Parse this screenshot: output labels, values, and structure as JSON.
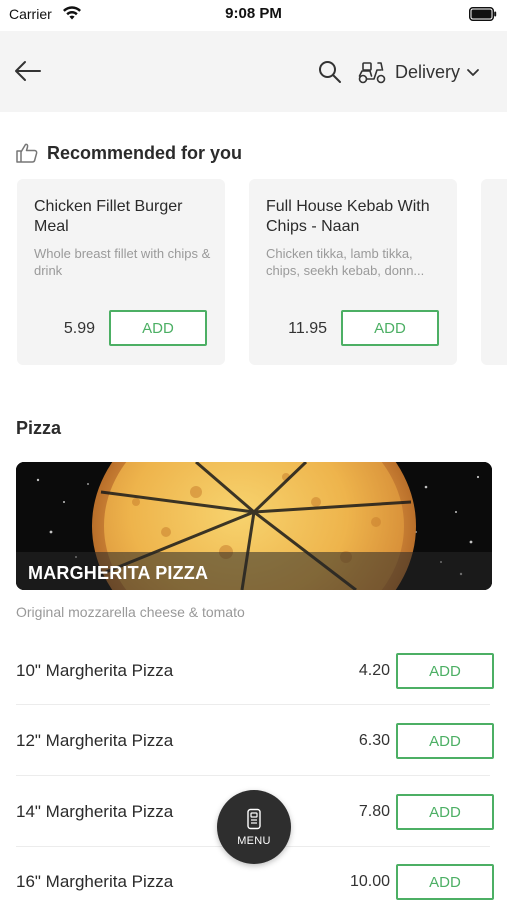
{
  "status_bar": {
    "carrier": "Carrier",
    "time": "9:08 PM"
  },
  "top_bar": {
    "delivery_label": "Delivery",
    "icons": [
      "back-arrow-icon",
      "search-icon",
      "scooter-icon",
      "chevron-down-icon"
    ]
  },
  "recommended": {
    "title": "Recommended for you",
    "icon": "thumbs-up-icon",
    "cards": [
      {
        "name": "Chicken Fillet Burger Meal",
        "description": "Whole breast fillet with chips & drink",
        "price": "5.99",
        "add_label": "ADD"
      },
      {
        "name": "Full House Kebab With Chips - Naan",
        "description": "Chicken tikka, lamb tikka, chips, seekh kebab, donn...",
        "price": "11.95",
        "add_label": "ADD"
      }
    ]
  },
  "section": {
    "title": "Pizza",
    "banner_title": "MARGHERITA PIZZA",
    "description": "Original mozzarella cheese & tomato",
    "items": [
      {
        "name": "10\" Margherita Pizza",
        "price": "4.20",
        "add_label": "ADD"
      },
      {
        "name": "12\" Margherita Pizza",
        "price": "6.30",
        "add_label": "ADD"
      },
      {
        "name": "14\" Margherita Pizza",
        "price": "7.80",
        "add_label": "ADD"
      },
      {
        "name": "16\" Margherita Pizza",
        "price": "10.00",
        "add_label": "ADD"
      }
    ]
  },
  "menu_button": {
    "label": "MENU",
    "icon": "menu-card-icon"
  },
  "colors": {
    "accent_green": "#4caf64",
    "header_bg": "#f4f4f4",
    "fab_bg": "#2e2e2e"
  }
}
